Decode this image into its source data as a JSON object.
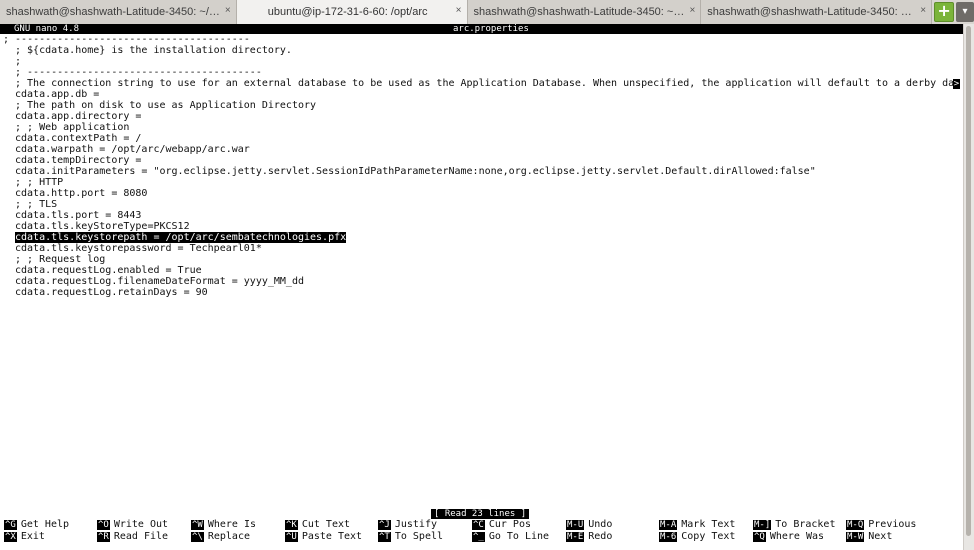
{
  "tabs": [
    {
      "label": "shashwath@shashwath-Latitude-3450: ~/Dow...",
      "close": "×"
    },
    {
      "label": "ubuntu@ip-172-31-6-60: /opt/arc",
      "close": "×"
    },
    {
      "label": "shashwath@shashwath-Latitude-3450: ~/Dow...",
      "close": "×"
    },
    {
      "label": "shashwath@shashwath-Latitude-3450: ~/Doc...",
      "close": "×"
    }
  ],
  "tab_add_symbol": "+",
  "tab_menu_symbol": "▾",
  "nano": {
    "version": "GNU nano 4.8",
    "filename": "arc.properties"
  },
  "lines": [
    "; ---------------------------------------",
    "; ${cdata.home} is the installation directory.",
    ";",
    "; ---------------------------------------",
    "; The connection string to use for an external database to be used as the Application Database. When unspecified, the application will default to a derby databas",
    "cdata.app.db =",
    "; The path on disk to use as Application Directory",
    "cdata.app.directory =",
    "; ; Web application",
    "cdata.contextPath = /",
    "cdata.warpath = /opt/arc/webapp/arc.war",
    "cdata.tempDirectory =",
    "cdata.initParameters = \"org.eclipse.jetty.servlet.SessionIdPathParameterName:none,org.eclipse.jetty.servlet.Default.dirAllowed:false\"",
    "; ; HTTP",
    "cdata.http.port = 8080",
    "; ; TLS",
    "cdata.tls.port = 8443",
    "cdata.tls.keyStoreType=PKCS12",
    "cdata.tls.keystorepath = /opt/arc/sembatechnologies.pfx",
    "cdata.tls.keystorepassword = Techpearl01*",
    "; ; Request log",
    "cdata.requestLog.enabled = True",
    "cdata.requestLog.filenameDateFormat = yyyy_MM_dd",
    "cdata.requestLog.retainDays = 90"
  ],
  "truncation_marker": ">",
  "status_message": "[ Read 23 lines ]",
  "shortcuts_row1": [
    {
      "key": "^G",
      "label": "Get Help"
    },
    {
      "key": "^O",
      "label": "Write Out"
    },
    {
      "key": "^W",
      "label": "Where Is"
    },
    {
      "key": "^K",
      "label": "Cut Text"
    },
    {
      "key": "^J",
      "label": "Justify"
    },
    {
      "key": "^C",
      "label": "Cur Pos"
    },
    {
      "key": "M-U",
      "label": "Undo"
    },
    {
      "key": "M-A",
      "label": "Mark Text"
    },
    {
      "key": "M-]",
      "label": "To Bracket"
    },
    {
      "key": "M-Q",
      "label": "Previous"
    }
  ],
  "shortcuts_row2": [
    {
      "key": "^X",
      "label": "Exit"
    },
    {
      "key": "^R",
      "label": "Read File"
    },
    {
      "key": "^\\",
      "label": "Replace"
    },
    {
      "key": "^U",
      "label": "Paste Text"
    },
    {
      "key": "^T",
      "label": "To Spell"
    },
    {
      "key": "^_",
      "label": "Go To Line"
    },
    {
      "key": "M-E",
      "label": "Redo"
    },
    {
      "key": "M-6",
      "label": "Copy Text"
    },
    {
      "key": "^Q",
      "label": "Where Was"
    },
    {
      "key": "M-W",
      "label": "Next"
    }
  ]
}
